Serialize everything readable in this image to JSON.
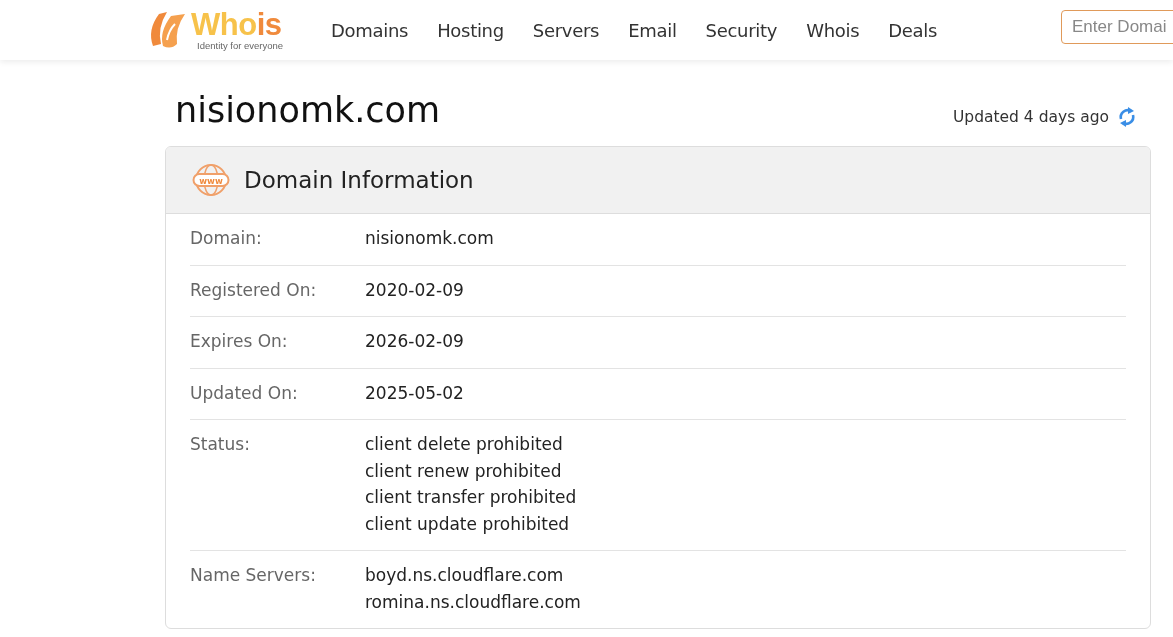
{
  "logo": {
    "name_parts": [
      "Who",
      "is"
    ],
    "tagline": "Identity for everyone"
  },
  "nav": [
    {
      "label": "Domains"
    },
    {
      "label": "Hosting"
    },
    {
      "label": "Servers"
    },
    {
      "label": "Email"
    },
    {
      "label": "Security"
    },
    {
      "label": "Whois"
    },
    {
      "label": "Deals"
    }
  ],
  "search": {
    "placeholder": "Enter Domai"
  },
  "domain_title": "nisionomk.com",
  "updated": "Updated 4 days ago",
  "card": {
    "icon_label": "www",
    "title": "Domain Information",
    "rows": [
      {
        "label": "Domain:",
        "values": [
          "nisionomk.com"
        ]
      },
      {
        "label": "Registered On:",
        "values": [
          "2020-02-09"
        ]
      },
      {
        "label": "Expires On:",
        "values": [
          "2026-02-09"
        ]
      },
      {
        "label": "Updated On:",
        "values": [
          "2025-05-02"
        ]
      },
      {
        "label": "Status:",
        "values": [
          "client delete prohibited",
          "client renew prohibited",
          "client transfer prohibited",
          "client update prohibited"
        ]
      },
      {
        "label": "Name Servers:",
        "values": [
          "boyd.ns.cloudflare.com",
          "romina.ns.cloudflare.com"
        ]
      }
    ]
  }
}
